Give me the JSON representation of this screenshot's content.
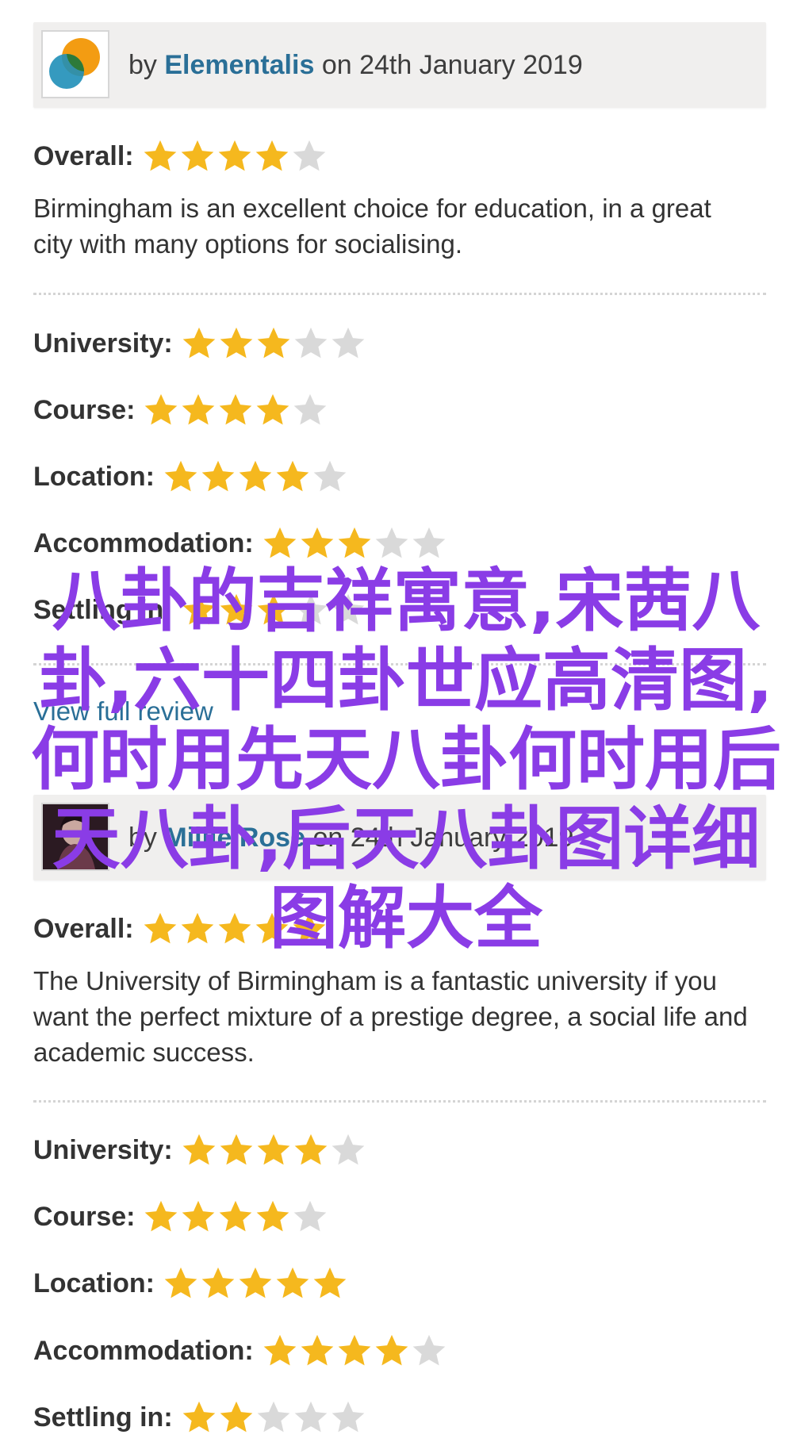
{
  "reviews": [
    {
      "by_prefix": "by",
      "author": "Elementalis",
      "date_text": "on 24th January 2019",
      "overall_label": "Overall:",
      "overall_rating": 4,
      "text": "Birmingham is an excellent choice for education, in a great city with many options for socialising.",
      "ratings": [
        {
          "label": "University:",
          "value": 3
        },
        {
          "label": "Course:",
          "value": 4
        },
        {
          "label": "Location:",
          "value": 4
        },
        {
          "label": "Accommodation:",
          "value": 3
        },
        {
          "label": "Settling in:",
          "value": 3
        }
      ],
      "view_full_review": "View full review"
    },
    {
      "by_prefix": "by",
      "author": "Millie Rose",
      "date_text": "on 24th January 2019",
      "overall_label": "Overall:",
      "overall_rating": 5,
      "text": "The University of Birmingham is a fantastic university if you want the perfect mixture of a prestige degree, a social life and academic success.",
      "ratings": [
        {
          "label": "University:",
          "value": 4
        },
        {
          "label": "Course:",
          "value": 4
        },
        {
          "label": "Location:",
          "value": 5
        },
        {
          "label": "Accommodation:",
          "value": 4
        },
        {
          "label": "Settling in:",
          "value": 2
        }
      ]
    }
  ],
  "rating_max": 5,
  "overlay_text": "八卦的吉祥寓意,宋茜八卦,六十四卦世应高清图,何时用先天八卦何时用后天八卦,后天八卦图详细图解大全",
  "colors": {
    "star_on": "#f5b81e",
    "star_off": "#d9d9d9",
    "author_link": "#2a6f97",
    "overlay": "#8a3ce6",
    "header_bg": "#f0efee"
  }
}
